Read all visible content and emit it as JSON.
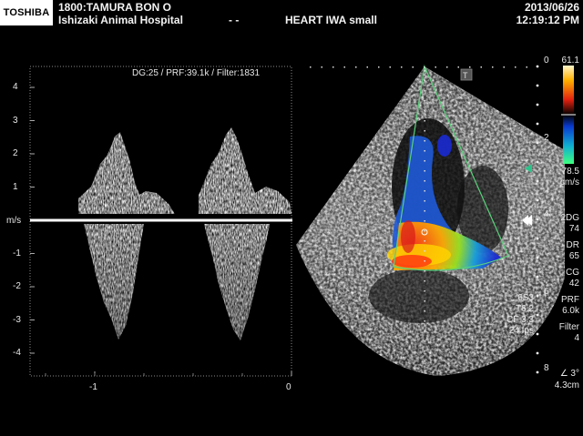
{
  "header": {
    "brand": "TOSHIBA",
    "patient_line": "1800:TAMURA   BON     O",
    "hospital_line": "Ishizaki Animal Hospital",
    "dashes": "- -",
    "preset": "HEART IWA small",
    "date": "2013/06/26",
    "time": "12:19:12 PM"
  },
  "doppler": {
    "params": "DG:25 /   PRF:39.1k / Filter:1831",
    "unit": "m/s",
    "velocity_ticks": [
      "4",
      "3",
      "2",
      "1",
      "-1",
      "-2",
      "-3",
      "-4"
    ],
    "time_ticks": [
      "-1",
      "0"
    ]
  },
  "color_doppler": {
    "depth_marks": [
      "0",
      "2",
      "4",
      "6",
      "8"
    ],
    "scale_top": "61.1",
    "scale_bottom": "78.5",
    "scale_unit": "cm/s",
    "probe_info": [
      "6S3",
      "T6.2",
      "CF 3.3",
      "24 fps"
    ],
    "settings": [
      {
        "label": "2DG",
        "value": "74"
      },
      {
        "label": "DR",
        "value": "65"
      },
      {
        "label": "CG",
        "value": "42"
      },
      {
        "label": "PRF",
        "value": "6.0k"
      },
      {
        "label": "Filter",
        "value": "4"
      }
    ],
    "angle": "∠ 3°",
    "depth": "4.3cm"
  },
  "colors": {
    "sector_outline": "#59d27a",
    "baseline": "#ffffff",
    "text": "#e8e8e8"
  }
}
